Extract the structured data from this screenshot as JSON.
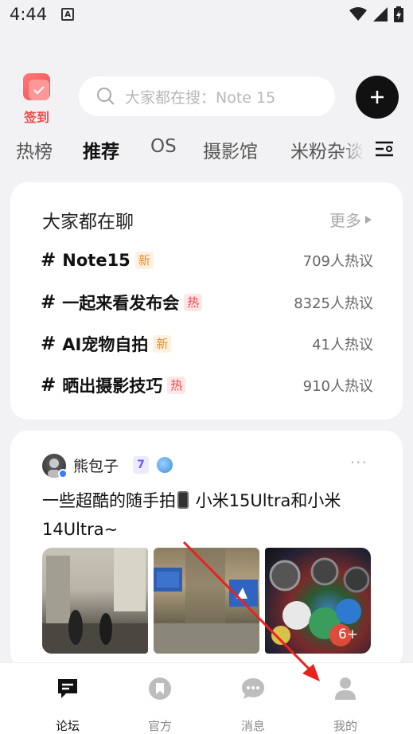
{
  "status": {
    "time": "4:44",
    "a_icon": "A"
  },
  "header": {
    "checkin_label": "签到",
    "search_placeholder": "大家都在搜：Note 15"
  },
  "tabs": [
    "热榜",
    "推荐",
    "OS",
    "摄影馆",
    "米粉杂谈"
  ],
  "active_tab": "推荐",
  "topics": {
    "heading": "大家都在聊",
    "more": "更多",
    "items": [
      {
        "name": "Note15",
        "tag": "新",
        "tag_type": "new",
        "count": "709人热议"
      },
      {
        "name": "一起来看发布会",
        "tag": "热",
        "tag_type": "hot",
        "count": "8325人热议"
      },
      {
        "name": "AI宠物自拍",
        "tag": "新",
        "tag_type": "new",
        "count": "41人热议"
      },
      {
        "name": "晒出摄影技巧",
        "tag": "热",
        "tag_type": "hot",
        "count": "910人热议"
      }
    ]
  },
  "post": {
    "author": "熊包子",
    "level": "7",
    "title_before": "一些超酷的随手拍",
    "title_after": " 小米15Ultra和小米14Ultra~",
    "more_photos": "6+"
  },
  "nav": {
    "items": [
      {
        "label": "论坛",
        "icon": "forum-icon",
        "active": true
      },
      {
        "label": "官方",
        "icon": "official-icon",
        "active": false
      },
      {
        "label": "消息",
        "icon": "message-icon",
        "active": false
      },
      {
        "label": "我的",
        "icon": "profile-icon",
        "active": false
      }
    ]
  },
  "colors": {
    "accent_red": "#f04848",
    "tag_new": "#f08a24",
    "level_purple": "#6a5cff",
    "arrow": "#e8231f"
  }
}
